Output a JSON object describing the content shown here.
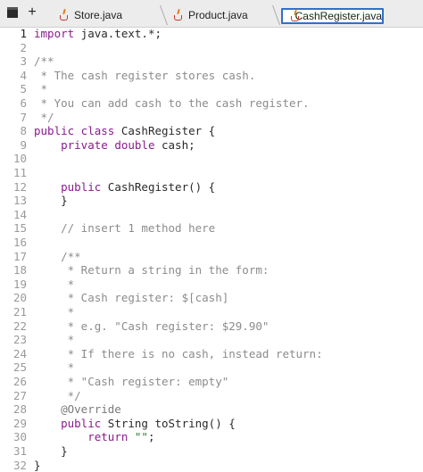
{
  "toolbar": {
    "terminal_icon": "terminal-icon",
    "add_label": "+"
  },
  "tabs": [
    {
      "label": "Store.java",
      "active": false
    },
    {
      "label": "Product.java",
      "active": false
    },
    {
      "label": "CashRegister.java",
      "active": true
    }
  ],
  "editor": {
    "lines": [
      {
        "n": "1",
        "segs": [
          {
            "t": "kw",
            "v": "import"
          },
          {
            "t": "",
            "v": " java.text.*;"
          }
        ]
      },
      {
        "n": "2",
        "segs": []
      },
      {
        "n": "3",
        "segs": [
          {
            "t": "cm",
            "v": "/**"
          }
        ]
      },
      {
        "n": "4",
        "segs": [
          {
            "t": "cm",
            "v": " * The cash register stores cash."
          }
        ]
      },
      {
        "n": "5",
        "segs": [
          {
            "t": "cm",
            "v": " *"
          }
        ]
      },
      {
        "n": "6",
        "segs": [
          {
            "t": "cm",
            "v": " * You can add cash to the cash register."
          }
        ]
      },
      {
        "n": "7",
        "segs": [
          {
            "t": "cm",
            "v": " */"
          }
        ]
      },
      {
        "n": "8",
        "segs": [
          {
            "t": "kw",
            "v": "public class"
          },
          {
            "t": "",
            "v": " CashRegister {"
          }
        ]
      },
      {
        "n": "9",
        "segs": [
          {
            "t": "",
            "v": "    "
          },
          {
            "t": "kw",
            "v": "private double"
          },
          {
            "t": "",
            "v": " cash;"
          }
        ]
      },
      {
        "n": "10",
        "segs": []
      },
      {
        "n": "11",
        "segs": []
      },
      {
        "n": "12",
        "segs": [
          {
            "t": "",
            "v": "    "
          },
          {
            "t": "kw",
            "v": "public"
          },
          {
            "t": "",
            "v": " CashRegister() {"
          }
        ]
      },
      {
        "n": "13",
        "segs": [
          {
            "t": "",
            "v": "    }"
          }
        ]
      },
      {
        "n": "14",
        "segs": []
      },
      {
        "n": "15",
        "segs": [
          {
            "t": "cm",
            "v": "    // insert 1 method here"
          }
        ]
      },
      {
        "n": "16",
        "segs": []
      },
      {
        "n": "17",
        "segs": [
          {
            "t": "cm",
            "v": "    /**"
          }
        ]
      },
      {
        "n": "18",
        "segs": [
          {
            "t": "cm",
            "v": "     * Return a string in the form:"
          }
        ]
      },
      {
        "n": "19",
        "segs": [
          {
            "t": "cm",
            "v": "     *"
          }
        ]
      },
      {
        "n": "20",
        "segs": [
          {
            "t": "cm",
            "v": "     * Cash register: $[cash]"
          }
        ]
      },
      {
        "n": "21",
        "segs": [
          {
            "t": "cm",
            "v": "     *"
          }
        ]
      },
      {
        "n": "22",
        "segs": [
          {
            "t": "cm",
            "v": "     * e.g. \"Cash register: $29.90\""
          }
        ]
      },
      {
        "n": "23",
        "segs": [
          {
            "t": "cm",
            "v": "     *"
          }
        ]
      },
      {
        "n": "24",
        "segs": [
          {
            "t": "cm",
            "v": "     * If there is no cash, instead return:"
          }
        ]
      },
      {
        "n": "25",
        "segs": [
          {
            "t": "cm",
            "v": "     *"
          }
        ]
      },
      {
        "n": "26",
        "segs": [
          {
            "t": "cm",
            "v": "     * \"Cash register: empty\""
          }
        ]
      },
      {
        "n": "27",
        "segs": [
          {
            "t": "cm",
            "v": "     */"
          }
        ]
      },
      {
        "n": "28",
        "segs": [
          {
            "t": "ann",
            "v": "    @Override"
          }
        ]
      },
      {
        "n": "29",
        "segs": [
          {
            "t": "",
            "v": "    "
          },
          {
            "t": "kw",
            "v": "public"
          },
          {
            "t": "",
            "v": " String toString() {"
          }
        ]
      },
      {
        "n": "30",
        "segs": [
          {
            "t": "",
            "v": "        "
          },
          {
            "t": "kw",
            "v": "return"
          },
          {
            "t": "",
            "v": " "
          },
          {
            "t": "str",
            "v": "\"\""
          },
          {
            "t": "",
            "v": ";"
          }
        ]
      },
      {
        "n": "31",
        "segs": [
          {
            "t": "",
            "v": "    }"
          }
        ]
      },
      {
        "n": "32",
        "segs": [
          {
            "t": "",
            "v": "}"
          }
        ]
      }
    ]
  },
  "colors": {
    "keyword": "#8a1a8e",
    "comment": "#8c8c8c",
    "string": "#2e7d32",
    "active_tab_border": "#2f6fcf"
  }
}
